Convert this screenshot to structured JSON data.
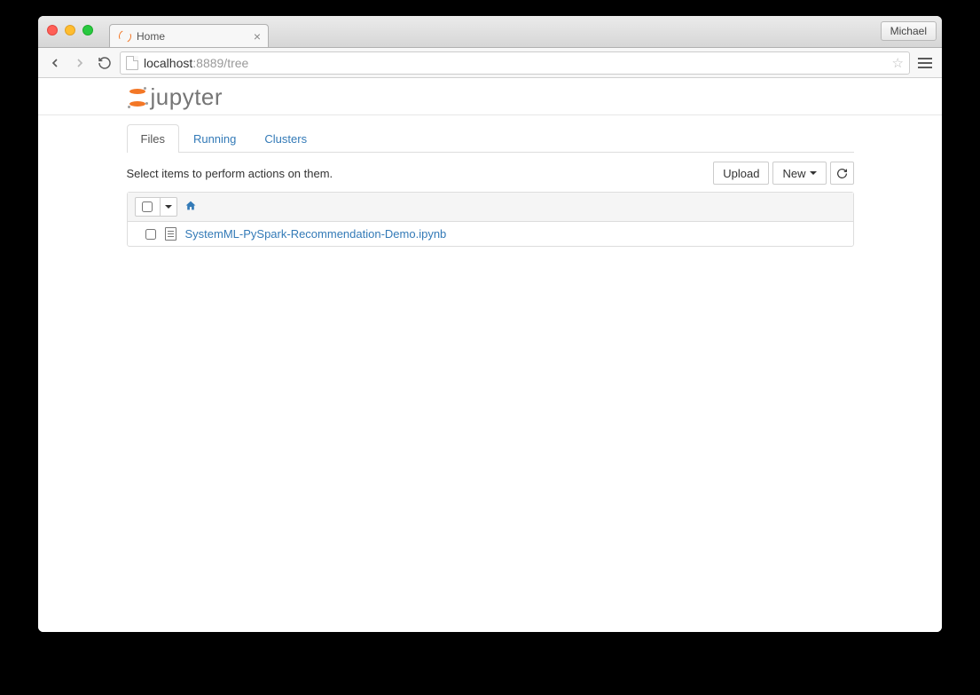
{
  "browser": {
    "user_button": "Michael",
    "tab_title": "Home",
    "url_host": "localhost",
    "url_rest": ":8889/tree"
  },
  "header": {
    "logo_text": "jupyter"
  },
  "tabs": {
    "files": "Files",
    "running": "Running",
    "clusters": "Clusters"
  },
  "toolbar": {
    "hint": "Select items to perform actions on them.",
    "upload": "Upload",
    "new": "New"
  },
  "files": [
    {
      "name": "SystemML-PySpark-Recommendation-Demo.ipynb"
    }
  ]
}
